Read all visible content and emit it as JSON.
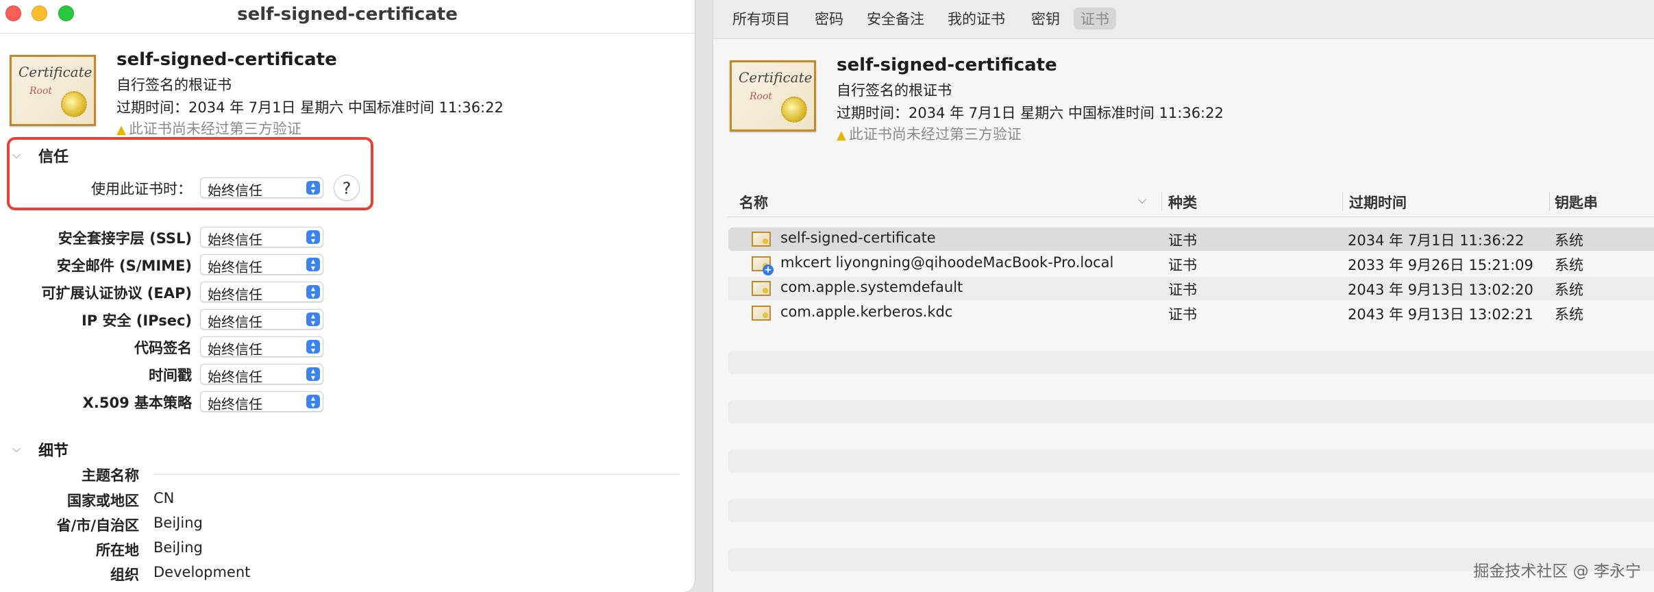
{
  "left_window": {
    "title": "self-signed-certificate",
    "header": {
      "name": "self-signed-certificate",
      "subtitle": "自行签名的根证书",
      "expiry": "过期时间：2034 年 7月1日 星期六 中国标准时间 11:36:22",
      "warning": "此证书尚未经过第三方验证",
      "icon_text": {
        "certificate": "Certificate",
        "root": "Root"
      }
    },
    "trust": {
      "heading": "信任",
      "main_label": "使用此证书时：",
      "main_value": "始终信任",
      "help": "?",
      "rows": [
        {
          "label": "安全套接字层 (SSL)",
          "value": "始终信任"
        },
        {
          "label": "安全邮件 (S/MIME)",
          "value": "始终信任"
        },
        {
          "label": "可扩展认证协议 (EAP)",
          "value": "始终信任"
        },
        {
          "label": "IP 安全 (IPsec)",
          "value": "始终信任"
        },
        {
          "label": "代码签名",
          "value": "始终信任"
        },
        {
          "label": "时间戳",
          "value": "始终信任"
        },
        {
          "label": "X.509 基本策略",
          "value": "始终信任"
        }
      ]
    },
    "details": {
      "heading": "细节",
      "subject_label": "主题名称",
      "rows": [
        {
          "label": "国家或地区",
          "value": "CN"
        },
        {
          "label": "省/市/自治区",
          "value": "BeiJing"
        },
        {
          "label": "所在地",
          "value": "BeiJing"
        },
        {
          "label": "组织",
          "value": "Development"
        }
      ]
    }
  },
  "right_window": {
    "tabs": [
      "所有项目",
      "密码",
      "安全备注",
      "我的证书",
      "密钥",
      "证书"
    ],
    "active_tab": "证书",
    "header": {
      "name": "self-signed-certificate",
      "subtitle": "自行签名的根证书",
      "expiry": "过期时间：2034 年 7月1日 星期六 中国标准时间 11:36:22",
      "warning": "此证书尚未经过第三方验证",
      "icon_text": {
        "certificate": "Certificate",
        "root": "Root"
      }
    },
    "columns": [
      "名称",
      "种类",
      "过期时间",
      "钥匙串"
    ],
    "rows": [
      {
        "name": "self-signed-certificate",
        "kind": "证书",
        "expires": "2034 年 7月1日 11:36:22",
        "keychain": "系统"
      },
      {
        "name": "mkcert liyongning@qihoodeMacBook-Pro.local",
        "kind": "证书",
        "expires": "2033 年 9月26日 15:21:09",
        "keychain": "系统"
      },
      {
        "name": "com.apple.systemdefault",
        "kind": "证书",
        "expires": "2043 年 9月13日 13:02:20",
        "keychain": "系统"
      },
      {
        "name": "com.apple.kerberos.kdc",
        "kind": "证书",
        "expires": "2043 年 9月13日 13:02:21",
        "keychain": "系统"
      }
    ],
    "watermark": "掘金技术社区 @ 李永宁"
  }
}
